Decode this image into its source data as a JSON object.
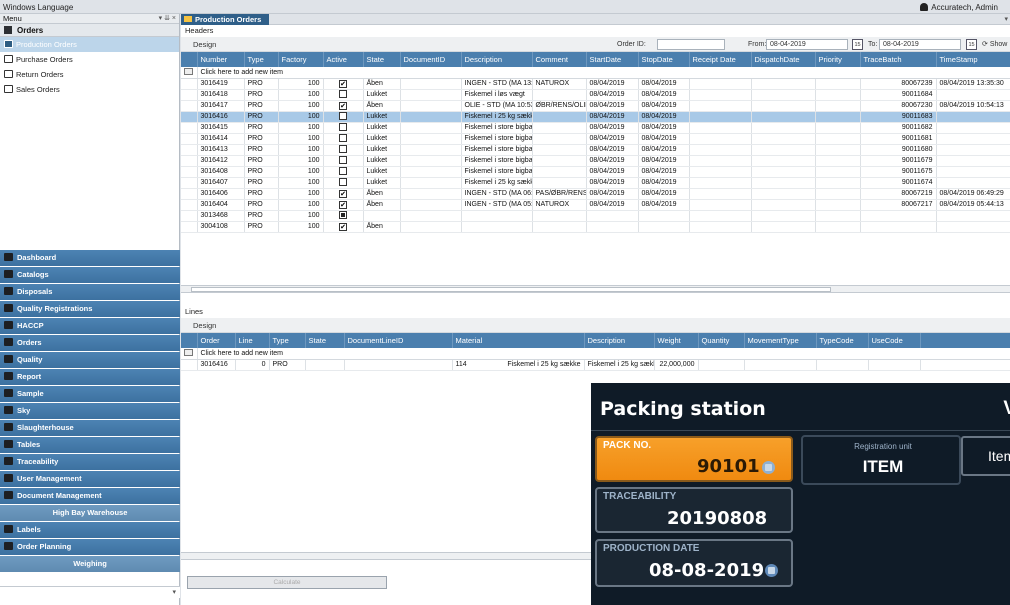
{
  "topbar": {
    "menu": "Windows  Language",
    "user": "Accuratech, Admin"
  },
  "sidebar": {
    "menu_label": "Menu",
    "menu_controls": "▾  ⇊  ×",
    "group_title": "Orders",
    "items": [
      {
        "label": "Production Orders",
        "selected": true
      },
      {
        "label": "Purchase Orders",
        "selected": false
      },
      {
        "label": "Return Orders",
        "selected": false
      },
      {
        "label": "Sales Orders",
        "selected": false
      }
    ],
    "nav": [
      {
        "label": "Dashboard",
        "style": "dark"
      },
      {
        "label": "Catalogs",
        "style": "dark"
      },
      {
        "label": "Disposals",
        "style": "dark"
      },
      {
        "label": "Quality Registrations",
        "style": "dark"
      },
      {
        "label": "HACCP",
        "style": "dark"
      },
      {
        "label": "Orders",
        "style": "dark"
      },
      {
        "label": "Quality",
        "style": "dark"
      },
      {
        "label": "Report",
        "style": "dark"
      },
      {
        "label": "Sample",
        "style": "dark"
      },
      {
        "label": "Sky",
        "style": "dark"
      },
      {
        "label": "Slaughterhouse",
        "style": "dark"
      },
      {
        "label": "Tables",
        "style": "dark"
      },
      {
        "label": "Traceability",
        "style": "dark"
      },
      {
        "label": "User Management",
        "style": "dark"
      },
      {
        "label": "Document Management",
        "style": "dark"
      },
      {
        "label": "High Bay Warehouse",
        "style": "center"
      },
      {
        "label": "Labels",
        "style": "dark"
      },
      {
        "label": "Order Planning",
        "style": "dark"
      },
      {
        "label": "Weighing",
        "style": "center"
      }
    ]
  },
  "main": {
    "tab_label": "Production Orders",
    "headers_label": "Headers",
    "design_label": "Design",
    "order_id_label": "Order ID:",
    "order_id_value": "",
    "from_label": "From:",
    "from_value": "08-04-2019",
    "to_label": "To:",
    "to_value": "08-04-2019",
    "cal_icon": "15",
    "show_label": "Show",
    "new_item_label": "Click here to add new item",
    "headers_columns": [
      "Number",
      "Type",
      "Factory",
      "Active",
      "State",
      "DocumentID",
      "Description",
      "Comment",
      "StartDate",
      "StopDate",
      "Receipt Date",
      "DispatchDate",
      "Priority",
      "TraceBatch",
      "TimeStamp"
    ],
    "headers_rows": [
      {
        "number": "3016419",
        "type": "PRO",
        "factory": "100",
        "active": "checked",
        "state": "Åben",
        "docid": "",
        "desc": "INGEN - STD (MA 13:35)",
        "comment": "NATUROX",
        "start": "08/04/2019",
        "stop": "08/04/2019",
        "receipt": "",
        "dispatch": "",
        "priority": "",
        "trace": "80067239",
        "ts": "08/04/2019 13:35:30"
      },
      {
        "number": "3016418",
        "type": "PRO",
        "factory": "100",
        "active": "unchecked",
        "state": "Lukket",
        "docid": "",
        "desc": "Fiskemel i løs vægt",
        "comment": "",
        "start": "08/04/2019",
        "stop": "08/04/2019",
        "receipt": "",
        "dispatch": "",
        "priority": "",
        "trace": "90011684",
        "ts": ""
      },
      {
        "number": "3016417",
        "type": "PRO",
        "factory": "100",
        "active": "checked",
        "state": "Åben",
        "docid": "",
        "desc": "OLIE - STD (MA 10:53)",
        "comment": "ØBR/RENS/OLIE",
        "start": "08/04/2019",
        "stop": "08/04/2019",
        "receipt": "",
        "dispatch": "",
        "priority": "",
        "trace": "80067230",
        "ts": "08/04/2019 10:54:13"
      },
      {
        "number": "3016416",
        "type": "PRO",
        "factory": "100",
        "active": "unchecked",
        "state": "Lukket",
        "docid": "",
        "desc": "Fiskemel i 25 kg sække",
        "comment": "",
        "start": "08/04/2019",
        "stop": "08/04/2019",
        "receipt": "",
        "dispatch": "",
        "priority": "",
        "trace": "90011683",
        "ts": "",
        "selected": true
      },
      {
        "number": "3016415",
        "type": "PRO",
        "factory": "100",
        "active": "unchecked",
        "state": "Lukket",
        "docid": "",
        "desc": "Fiskemel i store bigbags",
        "comment": "",
        "start": "08/04/2019",
        "stop": "08/04/2019",
        "receipt": "",
        "dispatch": "",
        "priority": "",
        "trace": "90011682",
        "ts": ""
      },
      {
        "number": "3016414",
        "type": "PRO",
        "factory": "100",
        "active": "unchecked",
        "state": "Lukket",
        "docid": "",
        "desc": "Fiskemel i store bigbags",
        "comment": "",
        "start": "08/04/2019",
        "stop": "08/04/2019",
        "receipt": "",
        "dispatch": "",
        "priority": "",
        "trace": "90011681",
        "ts": ""
      },
      {
        "number": "3016413",
        "type": "PRO",
        "factory": "100",
        "active": "unchecked",
        "state": "Lukket",
        "docid": "",
        "desc": "Fiskemel i store bigbags",
        "comment": "",
        "start": "08/04/2019",
        "stop": "08/04/2019",
        "receipt": "",
        "dispatch": "",
        "priority": "",
        "trace": "90011680",
        "ts": ""
      },
      {
        "number": "3016412",
        "type": "PRO",
        "factory": "100",
        "active": "unchecked",
        "state": "Lukket",
        "docid": "",
        "desc": "Fiskemel i store bigbags",
        "comment": "",
        "start": "08/04/2019",
        "stop": "08/04/2019",
        "receipt": "",
        "dispatch": "",
        "priority": "",
        "trace": "90011679",
        "ts": ""
      },
      {
        "number": "3016408",
        "type": "PRO",
        "factory": "100",
        "active": "unchecked",
        "state": "Lukket",
        "docid": "",
        "desc": "Fiskemel i store bigbags",
        "comment": "",
        "start": "08/04/2019",
        "stop": "08/04/2019",
        "receipt": "",
        "dispatch": "",
        "priority": "",
        "trace": "90011675",
        "ts": ""
      },
      {
        "number": "3016407",
        "type": "PRO",
        "factory": "100",
        "active": "unchecked",
        "state": "Lukket",
        "docid": "",
        "desc": "Fiskemel i 25 kg sække",
        "comment": "",
        "start": "08/04/2019",
        "stop": "08/04/2019",
        "receipt": "",
        "dispatch": "",
        "priority": "",
        "trace": "90011674",
        "ts": ""
      },
      {
        "number": "3016406",
        "type": "PRO",
        "factory": "100",
        "active": "checked",
        "state": "Åben",
        "docid": "",
        "desc": "INGEN - STD (MA 06:49)",
        "comment": "PAS/ØBR/RENS",
        "start": "08/04/2019",
        "stop": "08/04/2019",
        "receipt": "",
        "dispatch": "",
        "priority": "",
        "trace": "80067219",
        "ts": "08/04/2019 06:49:29"
      },
      {
        "number": "3016404",
        "type": "PRO",
        "factory": "100",
        "active": "checked",
        "state": "Åben",
        "docid": "",
        "desc": "INGEN - STD (MA 05:44)",
        "comment": "NATUROX",
        "start": "08/04/2019",
        "stop": "08/04/2019",
        "receipt": "",
        "dispatch": "",
        "priority": "",
        "trace": "80067217",
        "ts": "08/04/2019 05:44:13"
      },
      {
        "number": "3013468",
        "type": "PRO",
        "factory": "100",
        "active": "indeterminate",
        "state": "",
        "docid": "",
        "desc": "",
        "comment": "",
        "start": "",
        "stop": "",
        "receipt": "",
        "dispatch": "",
        "priority": "",
        "trace": "",
        "ts": ""
      },
      {
        "number": "3004108",
        "type": "PRO",
        "factory": "100",
        "active": "checked",
        "state": "Åben",
        "docid": "",
        "desc": "",
        "comment": "",
        "start": "",
        "stop": "",
        "receipt": "",
        "dispatch": "",
        "priority": "",
        "trace": "",
        "ts": ""
      }
    ],
    "lines_label": "Lines",
    "lines_columns": [
      "Order",
      "Line",
      "Type",
      "State",
      "DocumentLineID",
      "Material",
      "Description",
      "Weight",
      "Quantity",
      "MovementType",
      "TypeCode",
      "UseCode"
    ],
    "lines_rows": [
      {
        "order": "3016416",
        "line": "0",
        "type": "PRO",
        "state": "",
        "doclineid": "",
        "material_code": "114",
        "material": "Fiskemel i 25 kg sække",
        "desc": "Fiskemel i 25 kg sække",
        "weight": "22,000,000",
        "qty": "",
        "mov": "",
        "typecode": "",
        "usecode": ""
      }
    ],
    "calculate_label": "Calculate"
  },
  "packing": {
    "title": "Packing station",
    "right_cut": "V",
    "pack_no_label": "PACK NO.",
    "pack_no_value": "90101",
    "registration_label": "Registration unit",
    "registration_value": "ITEM",
    "item_tab": "Item",
    "traceability_label": "TRACEABILITY",
    "traceability_value": "20190808",
    "production_date_label": "PRODUCTION DATE",
    "production_date_value": "08-08-2019",
    "colors": {
      "pack_bg": "#0f1b27",
      "accent": "#f08a10"
    }
  }
}
